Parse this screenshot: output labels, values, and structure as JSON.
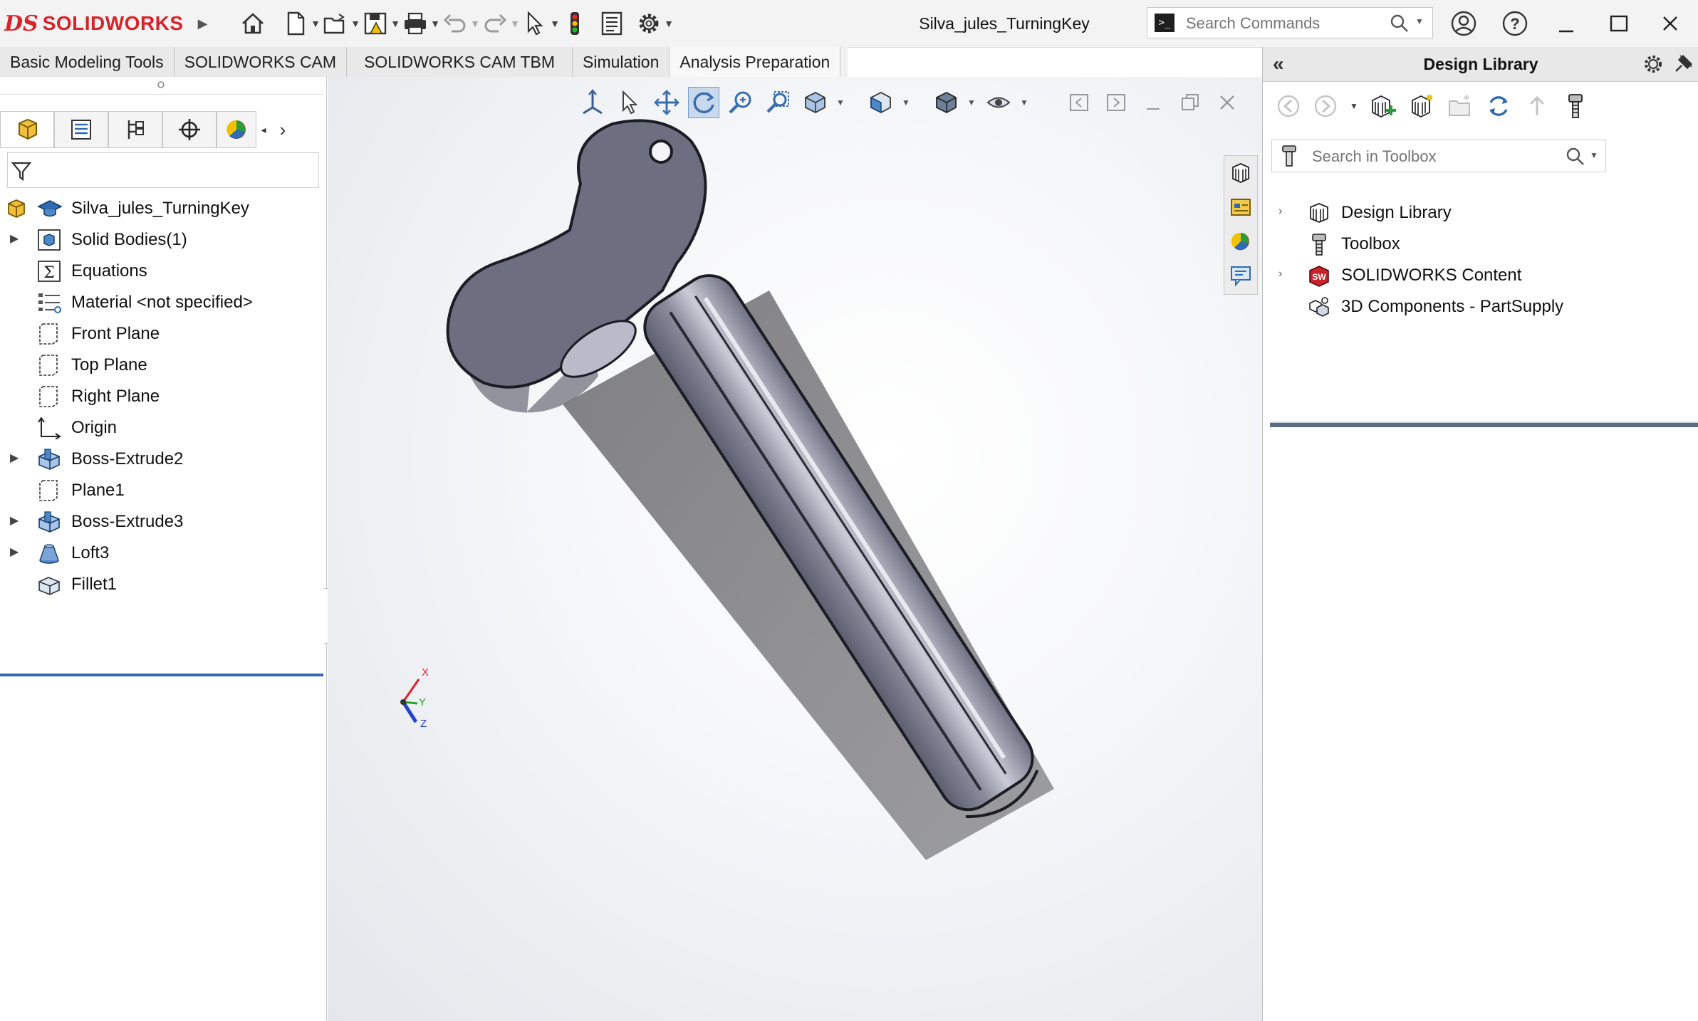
{
  "app": {
    "brand_prefix": "DS",
    "brand_name": "SOLIDWORKS",
    "document_title": "Silva_jules_TurningKey"
  },
  "search_commands": {
    "placeholder": "Search Commands"
  },
  "tabs": [
    {
      "label": "Basic Modeling Tools"
    },
    {
      "label": "SOLIDWORKS CAM"
    },
    {
      "label": "SOLIDWORKS CAM TBM"
    },
    {
      "label": "Simulation"
    },
    {
      "label": "Analysis Preparation"
    }
  ],
  "feature_tree": {
    "root": "Silva_jules_TurningKey",
    "items": [
      {
        "label": "Solid Bodies(1)",
        "icon": "solid-bodies-icon",
        "expandable": true
      },
      {
        "label": "Equations",
        "icon": "equations-icon",
        "expandable": false
      },
      {
        "label": "Material <not specified>",
        "icon": "material-icon",
        "expandable": false
      },
      {
        "label": "Front Plane",
        "icon": "plane-icon",
        "expandable": false
      },
      {
        "label": "Top Plane",
        "icon": "plane-icon",
        "expandable": false
      },
      {
        "label": "Right Plane",
        "icon": "plane-icon",
        "expandable": false
      },
      {
        "label": "Origin",
        "icon": "origin-icon",
        "expandable": false
      },
      {
        "label": "Boss-Extrude2",
        "icon": "boss-extrude-icon",
        "expandable": true
      },
      {
        "label": "Plane1",
        "icon": "plane-icon",
        "expandable": false
      },
      {
        "label": "Boss-Extrude3",
        "icon": "boss-extrude-icon",
        "expandable": true
      },
      {
        "label": "Loft3",
        "icon": "loft-icon",
        "expandable": true
      },
      {
        "label": "Fillet1",
        "icon": "fillet-icon",
        "expandable": false
      }
    ]
  },
  "triad": {
    "x": "X",
    "y": "Y",
    "z": "Z"
  },
  "design_library": {
    "title": "Design Library",
    "search_placeholder": "Search in Toolbox",
    "items": [
      {
        "label": "Design Library",
        "icon": "design-library-icon",
        "expandable": true
      },
      {
        "label": "Toolbox",
        "icon": "toolbox-icon",
        "expandable": false
      },
      {
        "label": "SOLIDWORKS Content",
        "icon": "solidworks-content-icon",
        "expandable": true
      },
      {
        "label": "3D Components - PartSupply",
        "icon": "partsupply-icon",
        "expandable": false
      }
    ]
  },
  "colors": {
    "accent": "#2f6bb3",
    "brand": "#d8232a",
    "model": "#6d6f80"
  }
}
